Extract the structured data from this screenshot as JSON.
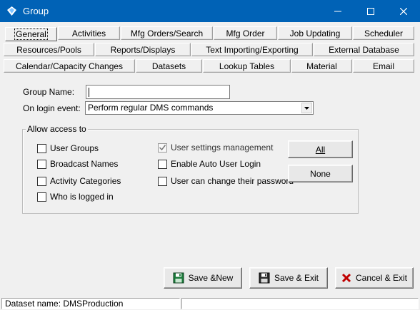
{
  "window": {
    "title": "Group"
  },
  "tabs": {
    "row1": [
      "General",
      "Activities",
      "Mfg Orders/Search",
      "Mfg Order",
      "Job Updating",
      "Scheduler"
    ],
    "row2": [
      "Resources/Pools",
      "Reports/Displays",
      "Text Importing/Exporting",
      "External Database"
    ],
    "row3": [
      "Calendar/Capacity Changes",
      "Datasets",
      "Lookup Tables",
      "Material",
      "Email"
    ],
    "active": "General"
  },
  "form": {
    "group_name_label": "Group Name:",
    "group_name_value": "",
    "on_login_label": "On login event:",
    "on_login_value": "Perform regular DMS commands"
  },
  "access": {
    "legend": "Allow access to",
    "checkboxes": [
      {
        "label": "User Groups",
        "checked": false,
        "enabled": true
      },
      {
        "label": "Broadcast Names",
        "checked": false,
        "enabled": true
      },
      {
        "label": "Activity Categories",
        "checked": false,
        "enabled": true
      },
      {
        "label": "Who is logged in",
        "checked": false,
        "enabled": true
      },
      {
        "label": "User settings management",
        "checked": true,
        "enabled": false
      },
      {
        "label": "Enable Auto User Login",
        "checked": false,
        "enabled": true
      },
      {
        "label": "User can change their password",
        "checked": false,
        "enabled": true
      }
    ],
    "all_button": "All",
    "none_button": "None"
  },
  "actions": {
    "save_new": "Save &New",
    "save_exit": "Save & Exit",
    "cancel_exit": "Cancel & Exit"
  },
  "status": {
    "dataset": "Dataset name:  DMSProduction"
  },
  "icons": {
    "app": "app-gem-icon",
    "save": "floppy-disk-icon",
    "cancel": "red-x-icon"
  },
  "colors": {
    "titlebar": "#0062b6",
    "cancel": "#c00000",
    "floppy": "#1a7a3a"
  }
}
